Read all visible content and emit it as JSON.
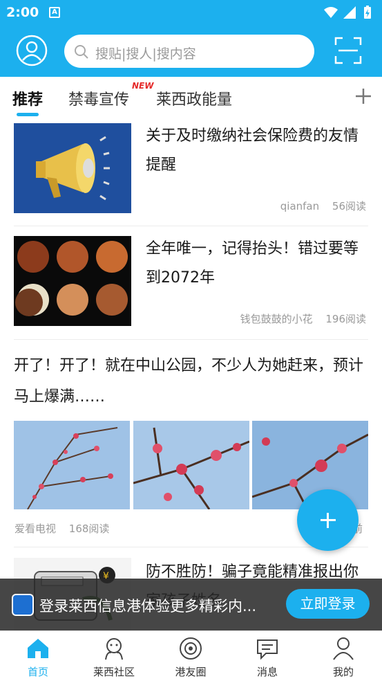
{
  "status_bar": {
    "time": "2:00",
    "notification_icon": "A"
  },
  "header": {
    "search_placeholder": "搜贴|搜人|搜内容"
  },
  "tabs": [
    {
      "label": "推荐",
      "active": true
    },
    {
      "label": "禁毒宣传",
      "badge": "NEW"
    },
    {
      "label": "莱西政能量"
    }
  ],
  "feed": [
    {
      "title": "关于及时缴纳社会保险费的友情提醒",
      "author": "qianfan",
      "reads": "56阅读"
    },
    {
      "title": "全年唯一，记得抬头！错过要等到2072年",
      "author": "钱包鼓鼓的小花",
      "reads": "196阅读"
    },
    {
      "title": "开了！开了！就在中山公园，不少人为她赶来，预计马上爆满……",
      "author": "爱看电视",
      "reads": "168阅读",
      "time_suffix": "前"
    },
    {
      "title": "防不胜防！骗子竟能精准报出你家孩子姓名"
    }
  ],
  "login_banner": {
    "text": "登录莱西信息港体验更多精彩内...",
    "button": "立即登录"
  },
  "bottom_nav": [
    {
      "label": "首页",
      "icon": "home-icon",
      "active": true
    },
    {
      "label": "莱西社区",
      "icon": "community-icon"
    },
    {
      "label": "港友圈",
      "icon": "circle-icon"
    },
    {
      "label": "消息",
      "icon": "message-icon"
    },
    {
      "label": "我的",
      "icon": "profile-icon"
    }
  ],
  "colors": {
    "accent": "#1cb0ee",
    "badge": "#e52a2a"
  }
}
